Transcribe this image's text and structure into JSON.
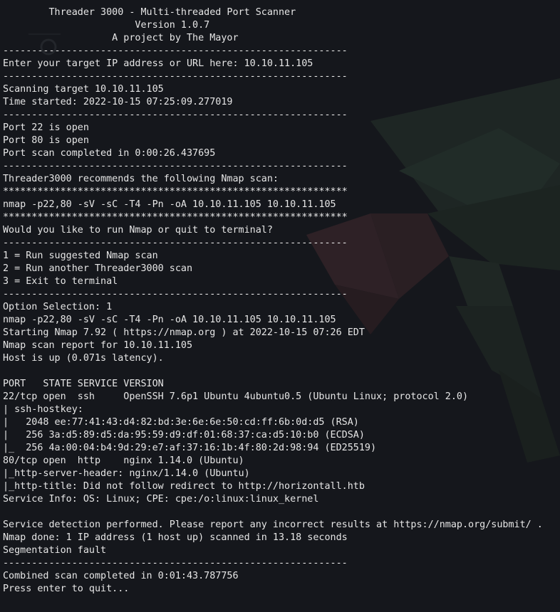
{
  "lines": [
    "------------------------------------------------------------",
    "        Threader 3000 - Multi-threaded Port Scanner",
    "                       Version 1.0.7",
    "                   A project by The Mayor",
    "------------------------------------------------------------",
    "Enter your target IP address or URL here: 10.10.11.105",
    "------------------------------------------------------------",
    "Scanning target 10.10.11.105",
    "Time started: 2022-10-15 07:25:09.277019",
    "------------------------------------------------------------",
    "Port 22 is open",
    "Port 80 is open",
    "Port scan completed in 0:00:26.437695",
    "------------------------------------------------------------",
    "Threader3000 recommends the following Nmap scan:",
    "************************************************************",
    "nmap -p22,80 -sV -sC -T4 -Pn -oA 10.10.11.105 10.10.11.105",
    "************************************************************",
    "Would you like to run Nmap or quit to terminal?",
    "------------------------------------------------------------",
    "1 = Run suggested Nmap scan",
    "2 = Run another Threader3000 scan",
    "3 = Exit to terminal",
    "------------------------------------------------------------",
    "Option Selection: 1",
    "nmap -p22,80 -sV -sC -T4 -Pn -oA 10.10.11.105 10.10.11.105",
    "Starting Nmap 7.92 ( https://nmap.org ) at 2022-10-15 07:26 EDT",
    "Nmap scan report for 10.10.11.105",
    "Host is up (0.071s latency).",
    "",
    "PORT   STATE SERVICE VERSION",
    "22/tcp open  ssh     OpenSSH 7.6p1 Ubuntu 4ubuntu0.5 (Ubuntu Linux; protocol 2.0)",
    "| ssh-hostkey:",
    "|   2048 ee:77:41:43:d4:82:bd:3e:6e:6e:50:cd:ff:6b:0d:d5 (RSA)",
    "|   256 3a:d5:89:d5:da:95:59:d9:df:01:68:37:ca:d5:10:b0 (ECDSA)",
    "|_  256 4a:00:04:b4:9d:29:e7:af:37:16:1b:4f:80:2d:98:94 (ED25519)",
    "80/tcp open  http    nginx 1.14.0 (Ubuntu)",
    "|_http-server-header: nginx/1.14.0 (Ubuntu)",
    "|_http-title: Did not follow redirect to http://horizontall.htb",
    "Service Info: OS: Linux; CPE: cpe:/o:linux:linux_kernel",
    "",
    "Service detection performed. Please report any incorrect results at https://nmap.org/submit/ .",
    "Nmap done: 1 IP address (1 host up) scanned in 13.18 seconds",
    "Segmentation fault",
    "------------------------------------------------------------",
    "Combined scan completed in 0:01:43.787756",
    "Press enter to quit..."
  ],
  "colors": {
    "background": "#15171c",
    "text": "#e6e6e6",
    "wallpaper_shape_dark": "#1f2a26",
    "wallpaper_shape_mid": "#24302c",
    "wallpaper_shape_red": "#3a2328"
  }
}
